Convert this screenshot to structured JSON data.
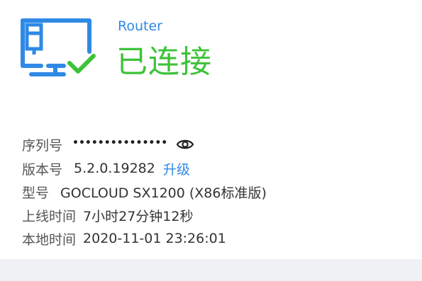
{
  "header": {
    "device_type": "Router",
    "status": "已连接"
  },
  "info": {
    "serial": {
      "label": "序列号",
      "masked_value": "•••••••••••••••"
    },
    "version": {
      "label": "版本号",
      "value": "5.2.0.19282",
      "upgrade_link": "升级"
    },
    "model": {
      "label": "型号",
      "value": "GOCLOUD SX1200 (X86标准版)"
    },
    "uptime": {
      "label": "上线时间",
      "value": "7小时27分钟12秒"
    },
    "local_time": {
      "label": "本地时间",
      "value": "2020-11-01 23:26:01"
    }
  },
  "icons": {
    "router": "router-connected-icon",
    "visibility": "eye-icon"
  },
  "colors": {
    "accent_blue": "#2f89e6",
    "status_green": "#3fc23a",
    "footer_bg": "#f0f1f4"
  }
}
